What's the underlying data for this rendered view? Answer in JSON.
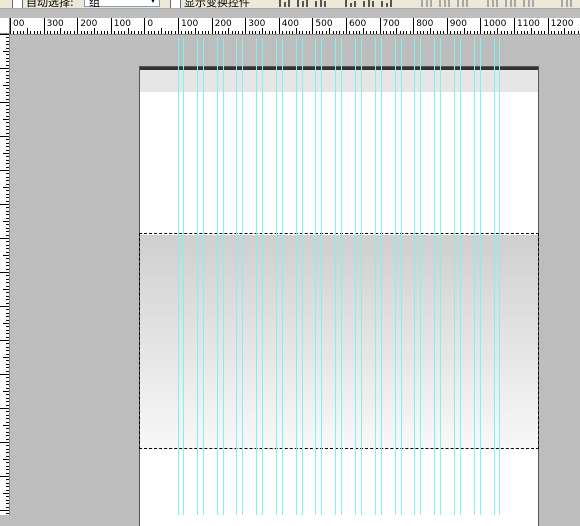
{
  "options_bar": {
    "auto_select_label": "自动选择:",
    "group_value": "组",
    "show_transform_label": "显示变换控件"
  },
  "ruler": {
    "labels": [
      "00",
      "300",
      "200",
      "100",
      "0",
      "100",
      "200",
      "300",
      "400",
      "500",
      "600",
      "700",
      "800",
      "900",
      "1000",
      "1100",
      "1200"
    ]
  },
  "colors": {
    "workspace": "#bdbdbd",
    "guide": "#7ff2f2",
    "canvas": "#ffffff"
  }
}
